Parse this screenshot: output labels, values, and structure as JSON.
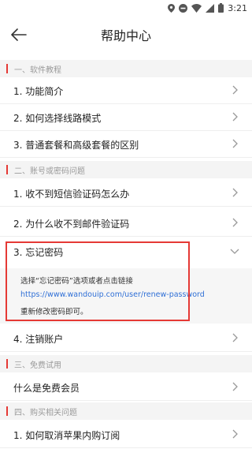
{
  "status": {
    "time": "3:21"
  },
  "header": {
    "title": "帮助中心"
  },
  "sections": {
    "s1": "一、软件教程",
    "s2": "二、账号或密码问题",
    "s3": "三、免费试用",
    "s4": "四、购买相关问题"
  },
  "rows": {
    "r1": "1. 功能简介",
    "r2": "2. 如何选择线路模式",
    "r3": "3. 普通套餐和高级套餐的区别",
    "r4": "1. 收不到短信验证码怎么办",
    "r5": "2. 为什么收不到邮件验证码",
    "r6": "3. 忘记密码",
    "r7": "4. 注销账户",
    "r8": "什么是免费会员",
    "r9": "1. 如何取消苹果内购订阅"
  },
  "answer": {
    "line1": "选择“忘记密码”选项或者点击链接",
    "link": "https://www.wandouip.com/user/renew-password",
    "line3": "重新修改密码即可。"
  },
  "colors": {
    "accent": "#e53935",
    "link": "#2f6fd6"
  }
}
